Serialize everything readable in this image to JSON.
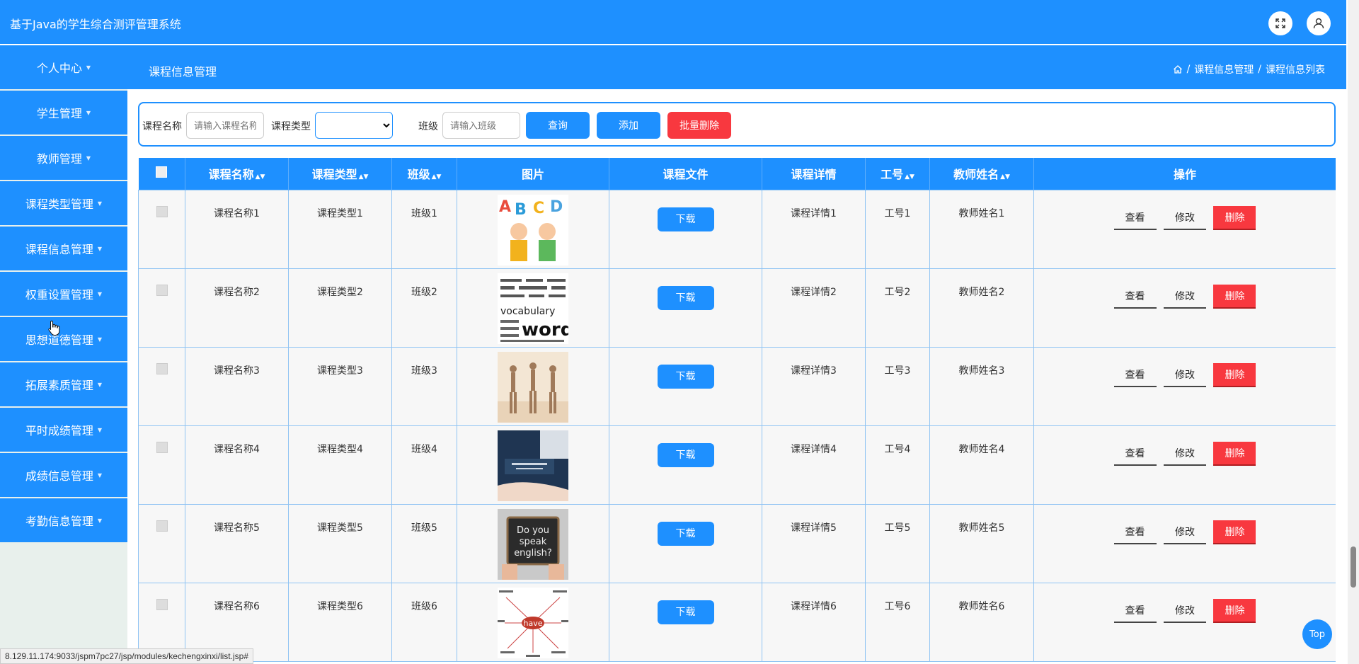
{
  "app": {
    "title": "基于Java的学生综合测评管理系统"
  },
  "sidebar": {
    "items": [
      {
        "label": "个人中心"
      },
      {
        "label": "学生管理"
      },
      {
        "label": "教师管理"
      },
      {
        "label": "课程类型管理"
      },
      {
        "label": "课程信息管理"
      },
      {
        "label": "权重设置管理"
      },
      {
        "label": "思想道德管理"
      },
      {
        "label": "拓展素质管理"
      },
      {
        "label": "平时成绩管理"
      },
      {
        "label": "成绩信息管理"
      },
      {
        "label": "考勤信息管理"
      }
    ]
  },
  "header": {
    "page_title": "课程信息管理",
    "breadcrumb": [
      "课程信息管理",
      "课程信息列表"
    ]
  },
  "search": {
    "name_label": "课程名称",
    "name_placeholder": "请输入课程名称",
    "type_label": "课程类型",
    "class_label": "班级",
    "class_placeholder": "请输入班级",
    "query_label": "查询",
    "add_label": "添加",
    "batch_delete_label": "批量删除"
  },
  "table": {
    "columns": [
      "课程名称",
      "课程类型",
      "班级",
      "图片",
      "课程文件",
      "课程详情",
      "工号",
      "教师姓名",
      "操作"
    ],
    "download_label": "下载",
    "actions": {
      "view": "查看",
      "edit": "修改",
      "delete": "删除"
    },
    "rows": [
      {
        "name": "课程名称1",
        "type": "课程类型1",
        "class": "班级1",
        "detail": "课程详情1",
        "emp_no": "工号1",
        "teacher": "教师姓名1"
      },
      {
        "name": "课程名称2",
        "type": "课程类型2",
        "class": "班级2",
        "detail": "课程详情2",
        "emp_no": "工号2",
        "teacher": "教师姓名2"
      },
      {
        "name": "课程名称3",
        "type": "课程类型3",
        "class": "班级3",
        "detail": "课程详情3",
        "emp_no": "工号3",
        "teacher": "教师姓名3"
      },
      {
        "name": "课程名称4",
        "type": "课程类型4",
        "class": "班级4",
        "detail": "课程详情4",
        "emp_no": "工号4",
        "teacher": "教师姓名4"
      },
      {
        "name": "课程名称5",
        "type": "课程类型5",
        "class": "班级5",
        "detail": "课程详情5",
        "emp_no": "工号5",
        "teacher": "教师姓名5"
      },
      {
        "name": "课程名称6",
        "type": "课程类型6",
        "class": "班级6",
        "detail": "课程详情6",
        "emp_no": "工号6",
        "teacher": "教师姓名6"
      }
    ]
  },
  "status_url": "8.129.11.174:9033/jspm7pc27/jsp/modules/kechengxinxi/list.jsp#",
  "scroll_top_label": "Top",
  "colors": {
    "primary": "#1E90FF",
    "danger": "#F8383F",
    "sidebar_bg": "#E8F0EC"
  }
}
